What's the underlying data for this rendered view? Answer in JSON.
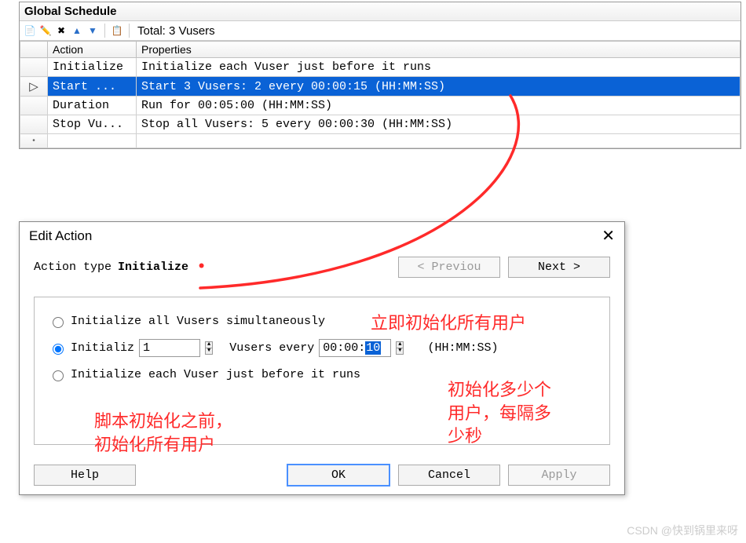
{
  "panel": {
    "title": "Global Schedule",
    "toolbar_total": "Total: 3 Vusers"
  },
  "table": {
    "headers": {
      "action": "Action",
      "properties": "Properties"
    },
    "rows": [
      {
        "marker": "",
        "action": "Initialize",
        "props": "Initialize each Vuser just before it runs",
        "selected": false
      },
      {
        "marker": "▷",
        "action": "Start  ...",
        "props": "Start 3 Vusers: 2 every 00:00:15 (HH:MM:SS)",
        "selected": true
      },
      {
        "marker": "",
        "action": "Duration",
        "props": "Run for 00:05:00 (HH:MM:SS)",
        "selected": false
      },
      {
        "marker": "",
        "action": "Stop Vu...",
        "props": "Stop all Vusers: 5 every 00:00:30 (HH:MM:SS)",
        "selected": false
      }
    ]
  },
  "dialog": {
    "title": "Edit Action",
    "action_type_label": "Action type",
    "action_type_value": "Initialize",
    "prev_btn": "<  Previou",
    "next_btn": "Next  >",
    "radios": {
      "opt1": "Initialize all Vusers simultaneously",
      "opt2_prefix": "Initializ",
      "opt2_count": "1",
      "opt2_mid": "Vusers every",
      "opt2_time_prefix": "00:00:",
      "opt2_time_sel": "10",
      "opt2_suffix": "(HH:MM:SS)",
      "opt3": "Initialize each Vuser just before it runs"
    },
    "buttons": {
      "help": "Help",
      "ok": "OK",
      "cancel": "Cancel",
      "apply": "Apply"
    }
  },
  "annotations": {
    "a1": "立即初始化所有用户",
    "a2": "脚本初始化之前，",
    "a2b": "初始化所有用户",
    "a3": "初始化多少个",
    "a3b": "用户，每隔多",
    "a3c": "少秒"
  },
  "watermark": "CSDN @快到锅里来呀"
}
